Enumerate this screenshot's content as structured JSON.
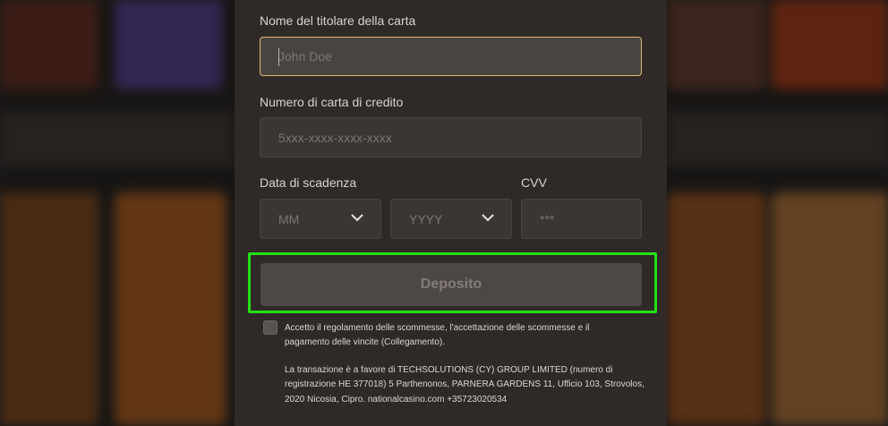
{
  "form": {
    "cardholder_label": "Nome del titolare della carta",
    "cardholder_placeholder": "John Doe",
    "card_number_label": "Numero di carta di credito",
    "card_number_placeholder": "5xxx-xxxx-xxxx-xxxx",
    "expiry_label": "Data di scadenza",
    "month_value": "MM",
    "year_value": "YYYY",
    "cvv_label": "CVV",
    "cvv_placeholder": "***",
    "deposit_label": "Deposito"
  },
  "terms": {
    "line1": "Accetto il regolamento delle scommesse, l'accettazione delle scommesse e il",
    "line2": "pagamento delle vincite (Collegamento)."
  },
  "legal": {
    "line1": "La transazione è a favore di TECHSOLUTIONS (CY) GROUP LIMITED (numero di",
    "line2": "registrazione HE 377018) 5 Parthenonos, PARNERA GARDENS 11, Ufficio 103, Strovolos,",
    "line3": "2020 Nicosia, Cipro. nationalcasino.com +35723020534"
  },
  "colors": {
    "highlight": "#22e114",
    "active_border": "#e0b97a",
    "panel": "#2f2a28"
  }
}
